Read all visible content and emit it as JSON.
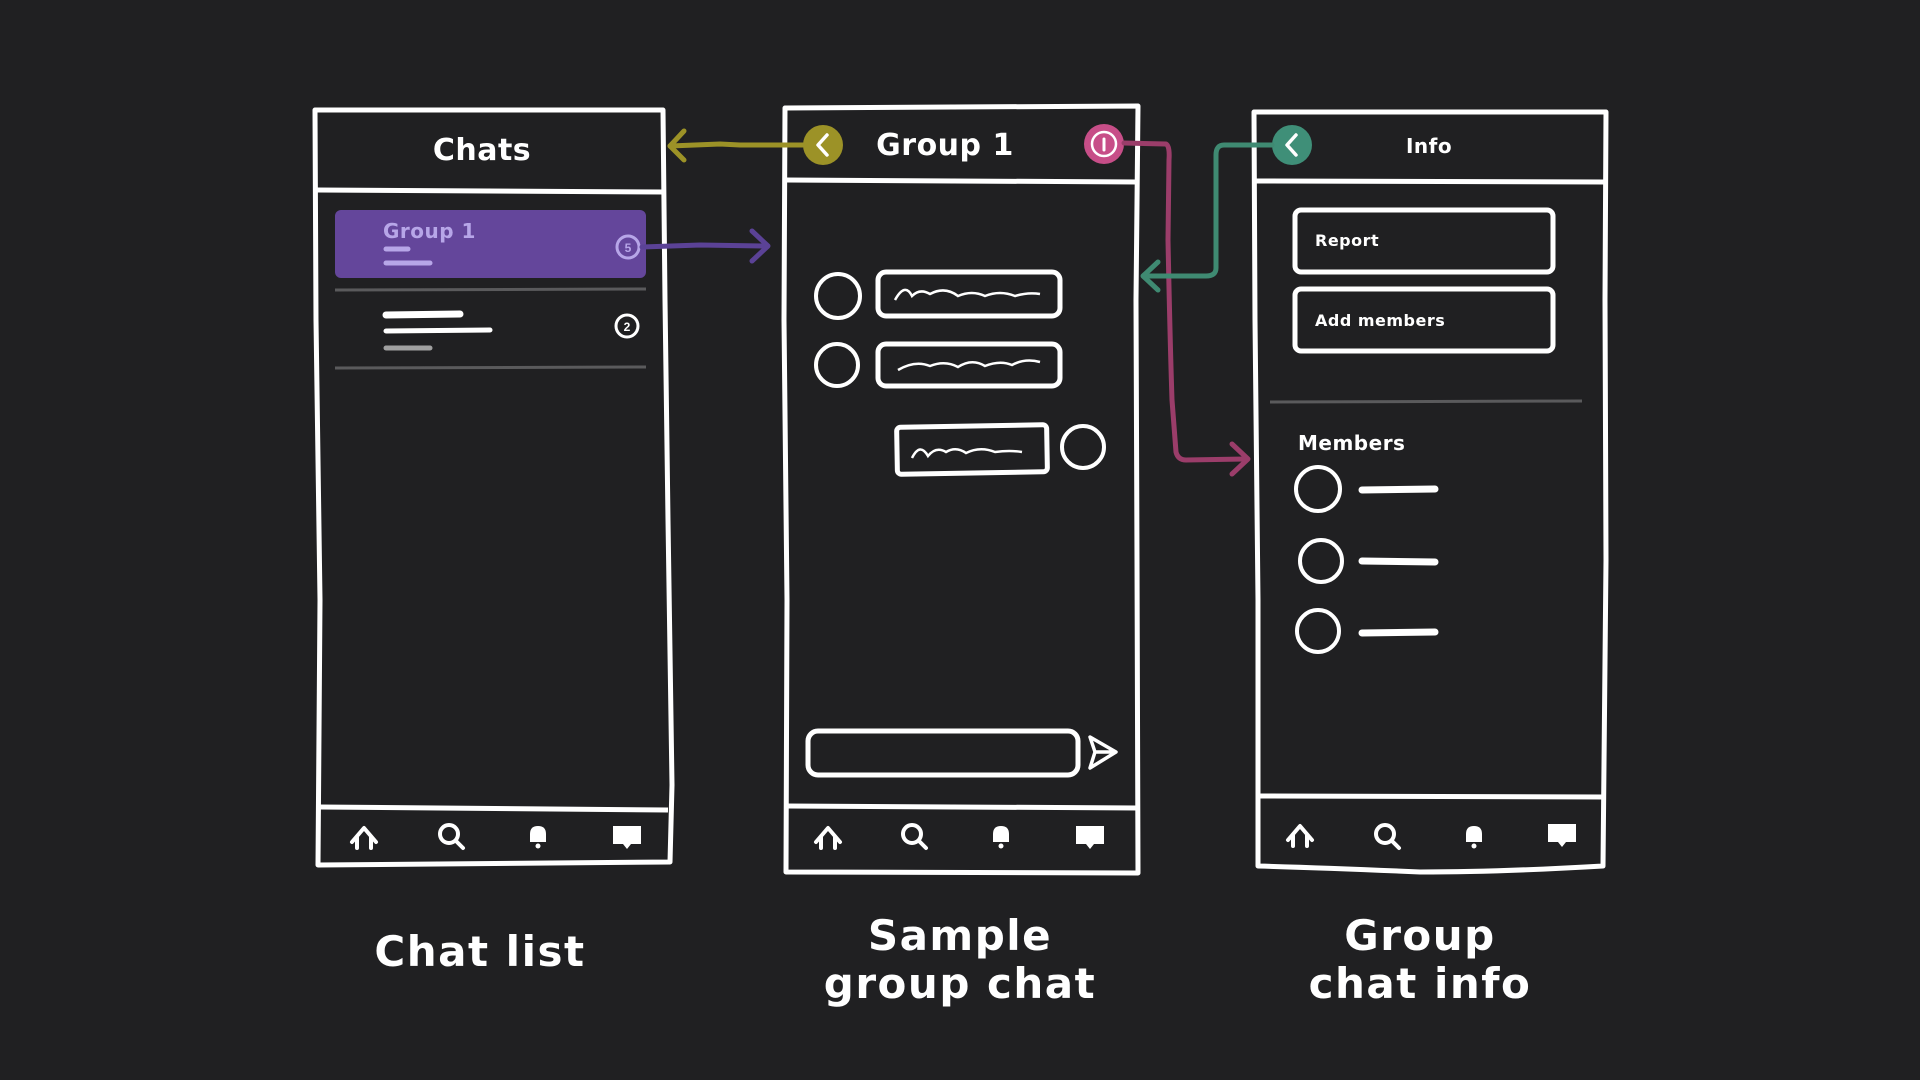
{
  "colors": {
    "background": "#202022",
    "stroke": "#ffffff",
    "purple": "#64469b",
    "purple_light": "#b7a6e8",
    "olive": "#9c9227",
    "pink": "#c74e88",
    "teal": "#3f8f78",
    "arrow_purple": "#5b4296",
    "arrow_pink": "#9b3d6a",
    "arrow_teal": "#3f8a72",
    "divider": "#5a5a5c"
  },
  "icons": {
    "back": "chevron-left-icon",
    "info": "info-icon",
    "send": "send-icon",
    "nav": [
      "home-icon",
      "search-icon",
      "bell-icon",
      "chat-icon"
    ]
  },
  "chat_list": {
    "title": "Chats",
    "items": [
      {
        "name": "Group 1",
        "unread": "5",
        "selected": true
      },
      {
        "name": "",
        "unread": "2",
        "selected": false
      }
    ],
    "caption": [
      "Chat list"
    ]
  },
  "group_chat": {
    "title": "Group 1",
    "caption": [
      "Sample",
      "group chat"
    ]
  },
  "group_info": {
    "title": "Info",
    "buttons": [
      "Report",
      "Add members"
    ],
    "members_heading": "Members",
    "member_count": 3,
    "caption": [
      "Group",
      "chat info"
    ]
  }
}
